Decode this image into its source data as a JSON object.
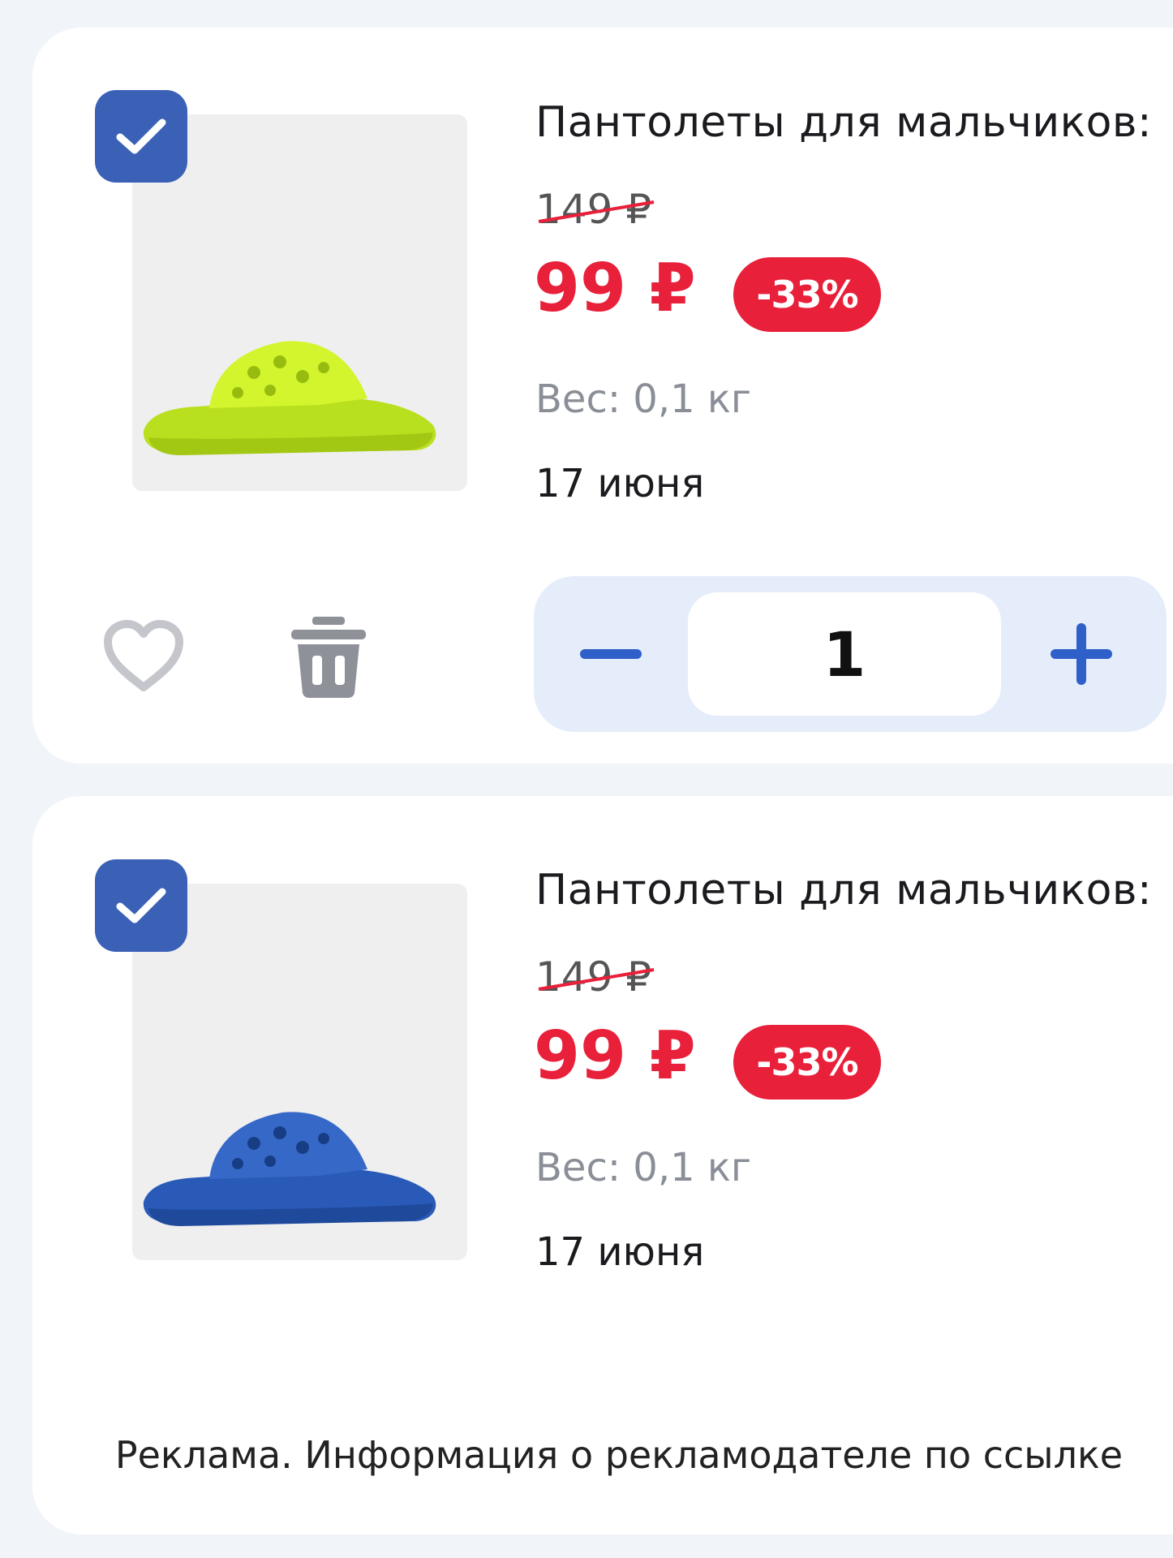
{
  "products": [
    {
      "title": "Пантолеты для мальчиков:",
      "old_price": "149 ₽",
      "new_price": "99 ₽",
      "discount": "-33%",
      "weight": "Вес: 0,1 кг",
      "delivery_date": "17 июня",
      "checked": true,
      "image_color": "#c6ef2a",
      "image_icon": "yellow-slide-sandal"
    },
    {
      "title": "Пантолеты для мальчиков:",
      "old_price": "149 ₽",
      "new_price": "99 ₽",
      "discount": "-33%",
      "weight": "Вес: 0,1 кг",
      "delivery_date": "17 июня",
      "checked": true,
      "image_color": "#2a5ab8",
      "image_icon": "blue-slide-sandal"
    }
  ],
  "stepper": {
    "quantity": "1",
    "minus_icon": "minus-icon",
    "plus_icon": "plus-icon"
  },
  "actions": {
    "favorite_icon": "heart-icon",
    "delete_icon": "trash-icon"
  },
  "ad_note": "Реклама. Информация о рекламодателе по ссылке",
  "colors": {
    "accent_red": "#e8203a",
    "checkbox_blue": "#3b61b7",
    "plus_blue": "#2f5fc8",
    "stepper_bg": "#e5edfb"
  }
}
